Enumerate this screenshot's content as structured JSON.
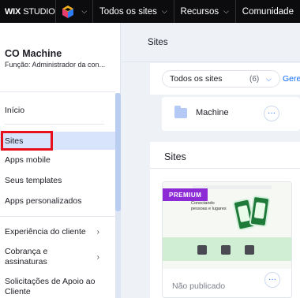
{
  "topbar": {
    "logo_bold": "WIX",
    "logo_rest": "STUDIO",
    "menus": [
      "Todos os sites",
      "Recursos",
      "Comunidade"
    ]
  },
  "sidebar": {
    "account_name": "CO Machine",
    "account_role": "Função: Administrador da con...",
    "items": [
      {
        "label": "Início"
      },
      {
        "label": "Sites",
        "active": true
      },
      {
        "label": "Apps mobile"
      },
      {
        "label": "Seus templates"
      },
      {
        "label": "Apps personalizados"
      },
      {
        "label": "Experiência do cliente",
        "has_chevron": true
      },
      {
        "label": "Cobrança e assinaturas",
        "has_chevron": true
      },
      {
        "label": "Solicitações de Apoio ao Cliente"
      }
    ]
  },
  "main": {
    "page_title": "Sites",
    "filter": {
      "label": "Todos os sites",
      "count": "(6)"
    },
    "manage_link": "Gere",
    "folder": {
      "name": "Machine"
    },
    "section_title": "Sites",
    "site_card": {
      "badge": "PREMIUM",
      "thumb_headline": "Conectando pessoas e lugares",
      "status": "Não publicado"
    }
  },
  "colors": {
    "accent": "#116dff",
    "premium": "#8c2bd6",
    "highlight": "#e6111c",
    "active_bg": "#d7e4fb"
  }
}
